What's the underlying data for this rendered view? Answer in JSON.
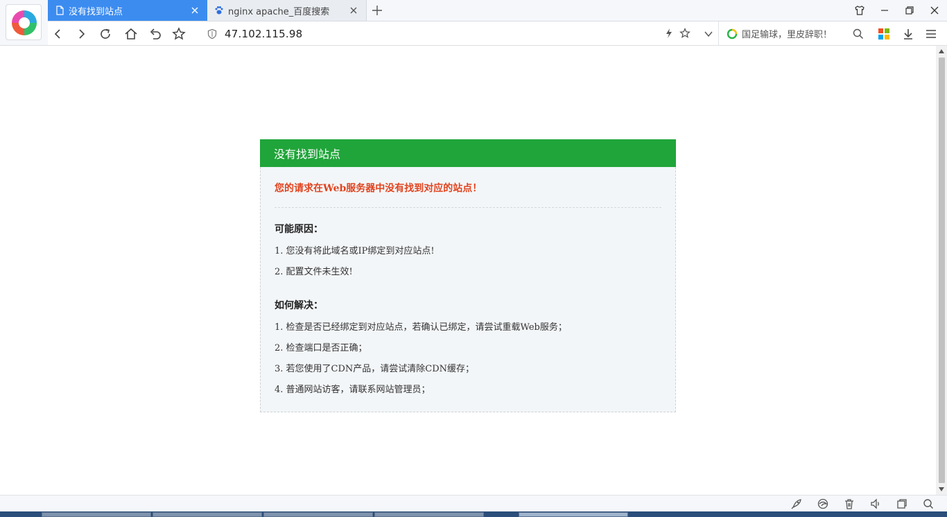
{
  "browser": {
    "tabs": [
      {
        "label": "没有找到站点",
        "active": true
      },
      {
        "label": "nginx apache_百度搜索",
        "active": false
      }
    ],
    "address": {
      "url": "47.102.115.98"
    },
    "search": {
      "hint": "国足输球，里皮辞职！"
    }
  },
  "page": {
    "header": "没有找到站点",
    "error": "您的请求在Web服务器中没有找到对应的站点！",
    "reasons": {
      "title": "可能原因：",
      "items": [
        "1. 您没有将此域名或IP绑定到对应站点!",
        "2. 配置文件未生效!"
      ]
    },
    "solutions": {
      "title": "如何解决：",
      "items": [
        "1. 检查是否已经绑定到对应站点，若确认已绑定，请尝试重载Web服务；",
        "2. 检查端口是否正确；",
        "3. 若您使用了CDN产品，请尝试清除CDN缓存；",
        "4. 普通网站访客，请联系网站管理员；"
      ]
    }
  },
  "colors": {
    "accent_tab": "#3c8cf0",
    "header_green": "#20a53a",
    "error_red": "#e1441f"
  },
  "icons": {
    "browser_logo": "360-browser-logo-icon",
    "status": [
      "rocket-icon",
      "edge-icon",
      "trash-icon",
      "volume-icon",
      "window-icon",
      "zoom-icon"
    ]
  }
}
